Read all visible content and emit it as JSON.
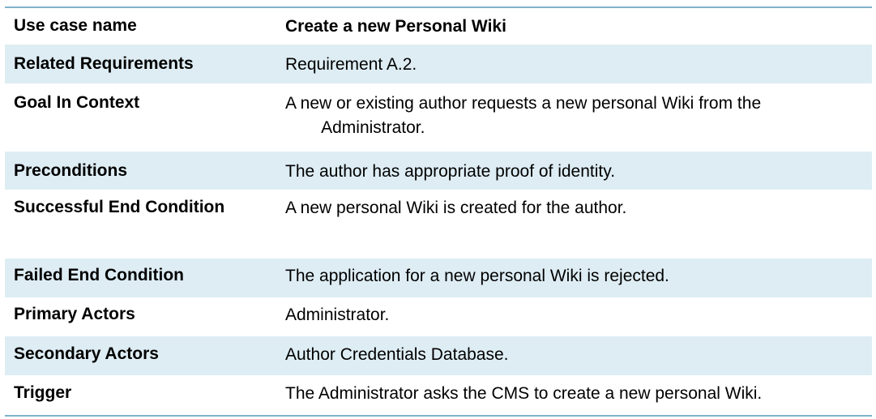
{
  "use_case_table": {
    "rows": [
      {
        "label": "Use case name",
        "value": "Create a new Personal Wiki"
      },
      {
        "label": "Related Requirements",
        "value": "Requirement A.2."
      },
      {
        "label": "Goal In Context",
        "value": "A new or existing author requests a new personal Wiki from the Administrator."
      },
      {
        "label": "Preconditions",
        "value": "The author has appropriate proof of identity."
      },
      {
        "label": "Successful End Condition",
        "value": "A new personal Wiki is created for the author."
      },
      {
        "label": "Failed End Condition",
        "value": "The application for a new personal Wiki is rejected."
      },
      {
        "label": "Primary Actors",
        "value": "Administrator."
      },
      {
        "label": "Secondary Actors",
        "value": "Author Credentials Database."
      },
      {
        "label": "Trigger",
        "value": "The Administrator asks the CMS to create a new personal Wiki."
      }
    ]
  }
}
